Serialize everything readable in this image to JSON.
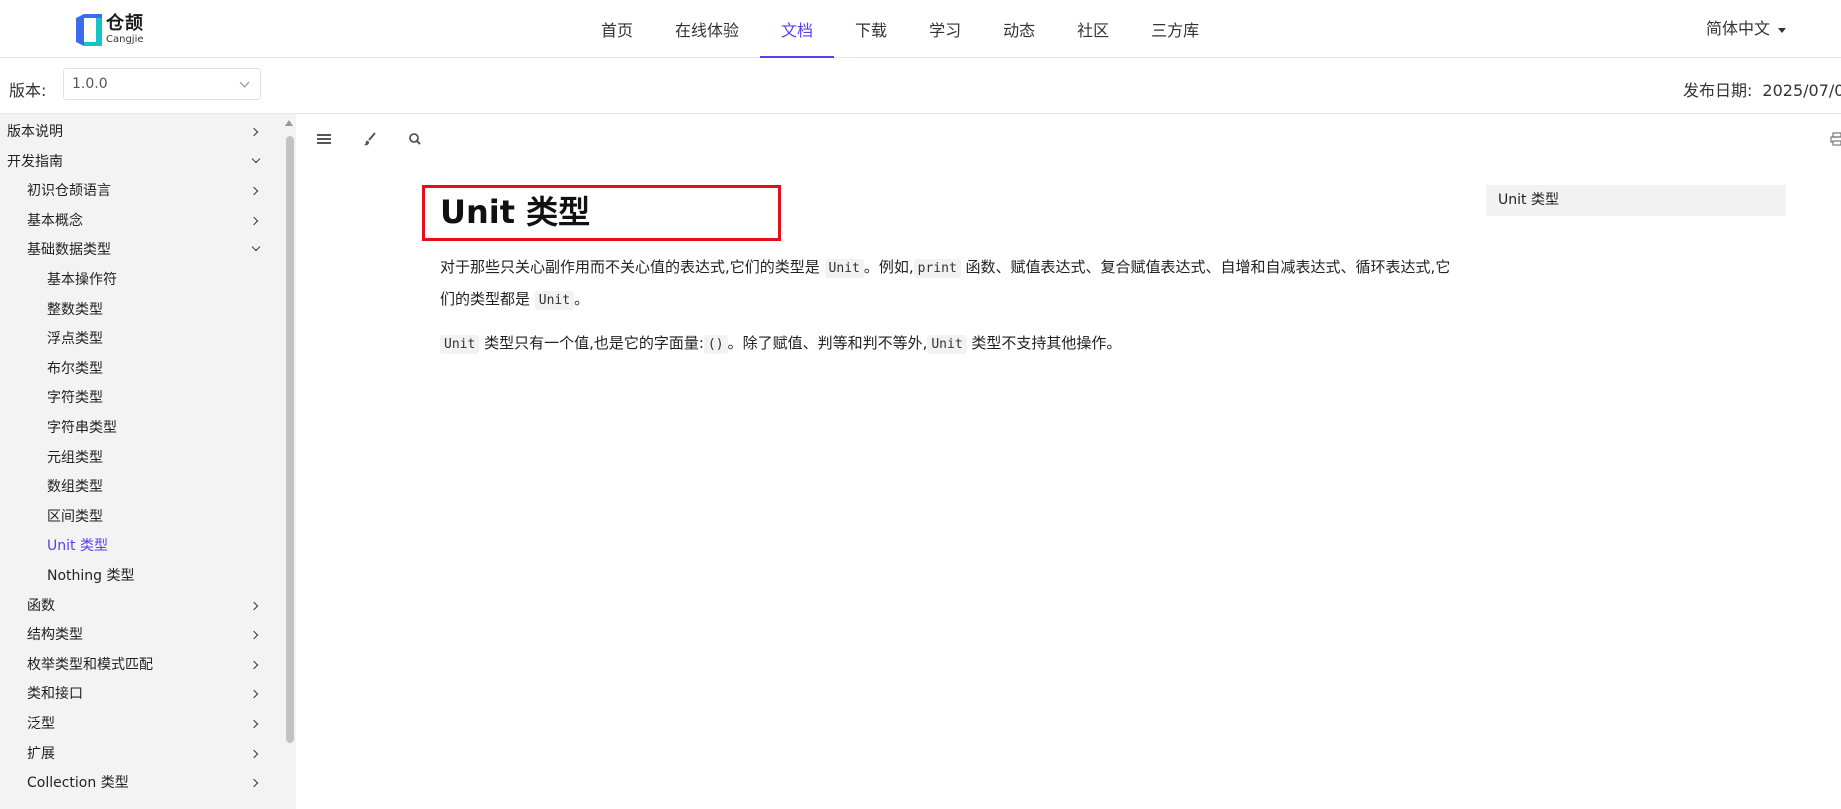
{
  "brand": {
    "cn": "仓颉",
    "en": "Cangjie",
    "colors": {
      "primary": "#5b3cf5",
      "logo_blue": "#3b6cf0",
      "logo_cyan": "#13c5c5",
      "highlight_box": "#e3101c"
    }
  },
  "nav": {
    "items": [
      "首页",
      "在线体验",
      "文档",
      "下载",
      "学习",
      "动态",
      "社区",
      "三方库"
    ],
    "active": "文档",
    "language": "简体中文"
  },
  "version_bar": {
    "label": "版本:",
    "selected": "1.0.0",
    "release_label": "发布日期:",
    "release_date": "2025/07/0"
  },
  "sidebar": {
    "items": [
      {
        "label": "版本说明",
        "level": 0,
        "state": "collapsed"
      },
      {
        "label": "开发指南",
        "level": 0,
        "state": "expanded"
      },
      {
        "label": "初识仓颉语言",
        "level": 1,
        "state": "collapsed"
      },
      {
        "label": "基本概念",
        "level": 1,
        "state": "collapsed"
      },
      {
        "label": "基础数据类型",
        "level": 1,
        "state": "expanded"
      },
      {
        "label": "基本操作符",
        "level": 2,
        "state": "none"
      },
      {
        "label": "整数类型",
        "level": 2,
        "state": "none"
      },
      {
        "label": "浮点类型",
        "level": 2,
        "state": "none"
      },
      {
        "label": "布尔类型",
        "level": 2,
        "state": "none"
      },
      {
        "label": "字符类型",
        "level": 2,
        "state": "none"
      },
      {
        "label": "字符串类型",
        "level": 2,
        "state": "none"
      },
      {
        "label": "元组类型",
        "level": 2,
        "state": "none"
      },
      {
        "label": "数组类型",
        "level": 2,
        "state": "none"
      },
      {
        "label": "区间类型",
        "level": 2,
        "state": "none"
      },
      {
        "label": "Unit 类型",
        "level": 2,
        "state": "active"
      },
      {
        "label": "Nothing 类型",
        "level": 2,
        "state": "none"
      },
      {
        "label": "函数",
        "level": 1,
        "state": "collapsed"
      },
      {
        "label": "结构类型",
        "level": 1,
        "state": "collapsed"
      },
      {
        "label": "枚举类型和模式匹配",
        "level": 1,
        "state": "collapsed"
      },
      {
        "label": "类和接口",
        "level": 1,
        "state": "collapsed"
      },
      {
        "label": "泛型",
        "level": 1,
        "state": "collapsed"
      },
      {
        "label": "扩展",
        "level": 1,
        "state": "collapsed"
      },
      {
        "label": "Collection 类型",
        "level": 1,
        "state": "collapsed"
      }
    ]
  },
  "toolbar": {
    "icons": [
      "menu-icon",
      "paintbrush-icon",
      "search-icon",
      "print-icon"
    ]
  },
  "content": {
    "title": "Unit 类型",
    "p1": {
      "t1": "对于那些只关心副作用而不关心值的表达式,它们的类型是 ",
      "c1": "Unit",
      "t2": "。例如,",
      "c2": "print",
      "t3": " 函数、赋值表达式、复合赋值表达式、自增和自减表达式、循环表达式,它们的类型都是 ",
      "c3": "Unit",
      "t4": "。"
    },
    "p2": {
      "c1": "Unit",
      "t1": " 类型只有一个值,也是它的字面量:",
      "c2": "()",
      "t2": "。除了赋值、判等和判不等外,",
      "c3": "Unit",
      "t3": " 类型不支持其他操作。"
    }
  },
  "toc": {
    "items": [
      "Unit 类型"
    ]
  }
}
